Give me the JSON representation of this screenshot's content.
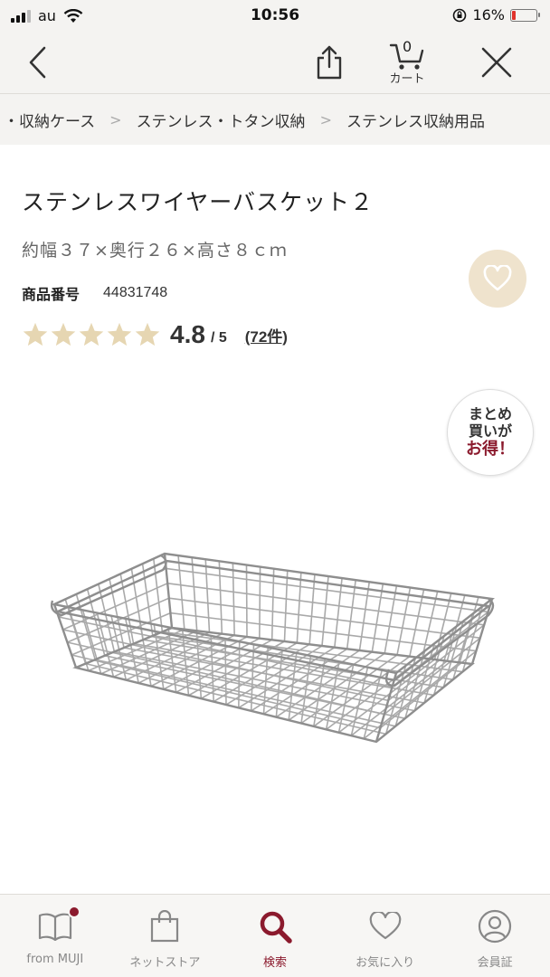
{
  "status_bar": {
    "carrier": "au",
    "time": "10:56",
    "battery_text": "16%",
    "battery_level": 0.16,
    "battery_color": "#e0332c"
  },
  "nav": {
    "back_icon": "chevron-left-icon",
    "share_icon": "share-icon",
    "cart_count": "0",
    "cart_label": "カート",
    "close_icon": "close-icon"
  },
  "breadcrumb": {
    "items": [
      "・収納ケース",
      "ステンレス・トタン収納",
      "ステンレス収納用品"
    ],
    "separator": ">"
  },
  "product": {
    "title": "ステンレスワイヤーバスケット２",
    "size": "約幅３７×奥行２６×高さ８ｃｍ",
    "sku_label": "商品番号",
    "sku_value": "44831748",
    "rating_value": "4.8",
    "rating_max": "/ 5",
    "rating_stars": 5,
    "review_count": "(72件)",
    "favorite_icon": "heart-icon"
  },
  "bulk_badge": {
    "line1": "まとめ",
    "line2": "買いが",
    "line3": "お得！"
  },
  "tab_bar": {
    "tabs": [
      {
        "label": "from MUJI",
        "icon": "book-icon"
      },
      {
        "label": "ネットストア",
        "icon": "shopping-bag-icon"
      },
      {
        "label": "検索",
        "icon": "search-icon"
      },
      {
        "label": "お気に入り",
        "icon": "heart-icon"
      },
      {
        "label": "会員証",
        "icon": "user-icon"
      }
    ],
    "active_index": 2
  },
  "colors": {
    "accent": "#8b1a2d",
    "star": "#e6d6b2",
    "fav_bg": "#efe3cd",
    "bar_bg": "#f4f3f1"
  }
}
